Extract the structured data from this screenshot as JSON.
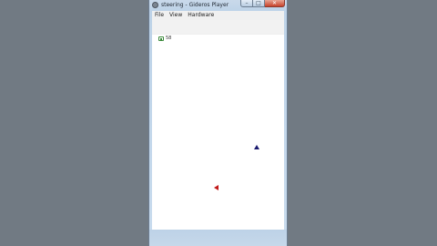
{
  "window": {
    "title": "steering - Gideros Player",
    "controls": {
      "minimize": "–",
      "maximize": "□",
      "close": "✕"
    }
  },
  "menu": {
    "items": [
      {
        "label": "File"
      },
      {
        "label": "View"
      },
      {
        "label": "Hardware"
      }
    ]
  },
  "canvas": {
    "fps_label": "58",
    "sprites": [
      {
        "name": "blue-triangle",
        "color": "#1a1a6e"
      },
      {
        "name": "red-triangle",
        "color": "#c01818"
      }
    ]
  },
  "colors": {
    "desktop": "#717a83",
    "frame": "#c4d8ec",
    "close_button": "#c8422b"
  }
}
